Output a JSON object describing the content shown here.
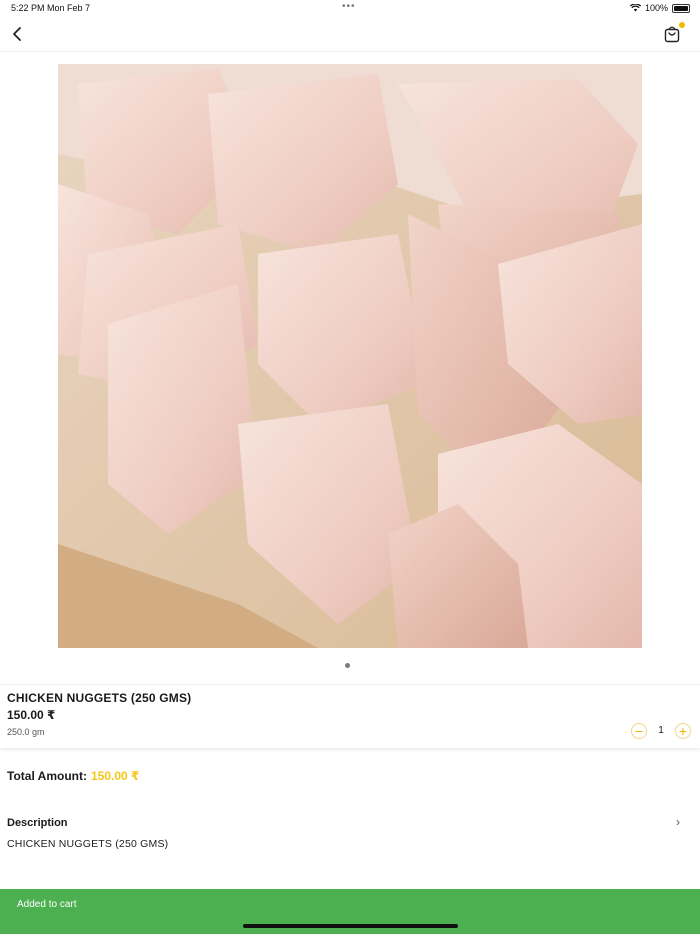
{
  "status_bar": {
    "time": "5:22 PM  Mon Feb 7",
    "dots": "•••",
    "battery": "100%"
  },
  "nav": {
    "back_icon": "chevron-left-icon",
    "cart_icon": "shopping-bag-icon"
  },
  "product": {
    "image_icon": "chicken-pieces-photo",
    "name": "CHICKEN NUGGETS (250 GMS)",
    "price": "150.00 ₹",
    "weight": "250.0 gm",
    "quantity": "1",
    "minus": "−",
    "plus": "+"
  },
  "total": {
    "label": "Total Amount:",
    "value": "150.00 ₹"
  },
  "description": {
    "title": "Description",
    "text": "CHICKEN NUGGETS (250 GMS)",
    "chevron": "›"
  },
  "toast": {
    "text": "Added to cart"
  },
  "colors": {
    "accent": "#f5c518",
    "toast": "#4caf50"
  }
}
